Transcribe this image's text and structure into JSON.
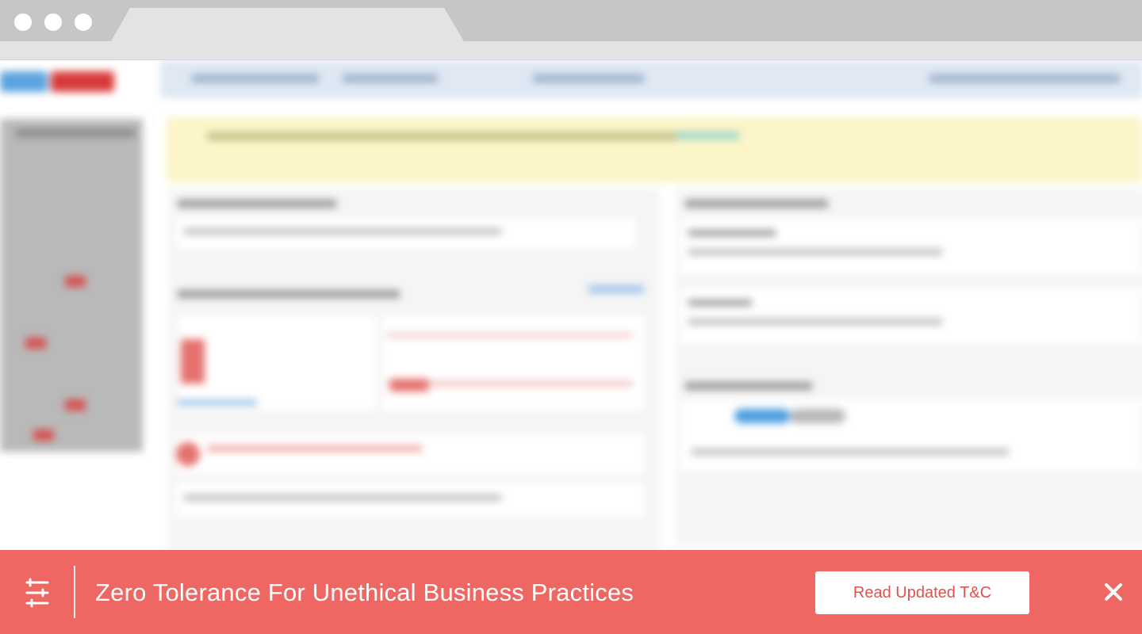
{
  "banner": {
    "message": "Zero Tolerance For Unethical Business Practices",
    "button_label": "Read Updated T&C",
    "background_color": "#ee6762",
    "icon": "sliders-icon",
    "close_icon": "close-icon"
  },
  "browser": {
    "window_controls": [
      "close-dot",
      "minimize-dot",
      "maximize-dot"
    ]
  },
  "background_page": {
    "state": "blurred",
    "brand_colors": [
      "#3d8fd6",
      "#d83a3a"
    ],
    "alert_color": "#fbf5c8"
  }
}
